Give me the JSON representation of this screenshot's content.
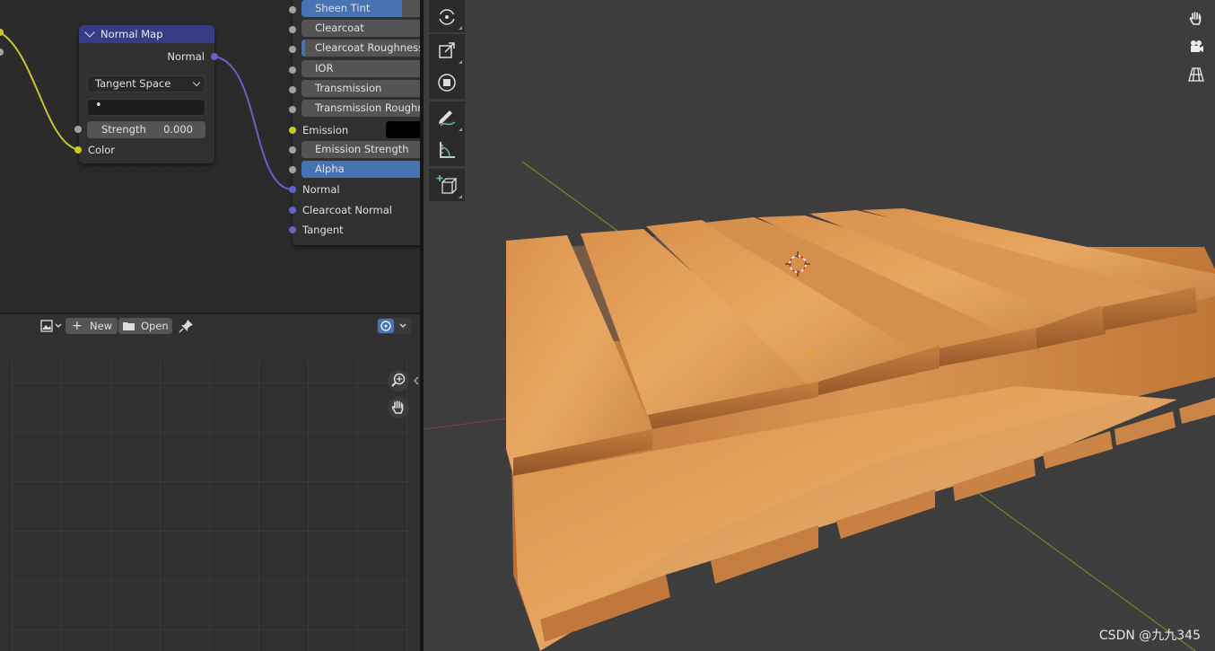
{
  "node_editor": {
    "normal_map_node": {
      "title": "Normal Map",
      "output_normal": "Normal",
      "space": "Tangent Space",
      "uv_map": "•",
      "strength_label": "Strength",
      "strength_value": "0.000",
      "input_color": "Color"
    },
    "bsdf_node": {
      "properties": [
        {
          "label": "Sheen Tint",
          "fill": 0.8
        },
        {
          "label": "Clearcoat",
          "fill": 0
        },
        {
          "label": "Clearcoat Roughness",
          "fill": 0.03
        },
        {
          "label": "IOR",
          "fill": 0
        },
        {
          "label": "Transmission",
          "fill": 0
        },
        {
          "label": "Transmission Roughness",
          "fill": 0
        }
      ],
      "emission_label": "Emission",
      "emission_color": "#000000",
      "emission_strength": "Emission Strength",
      "alpha_label": "Alpha",
      "alpha_fill": 1.0,
      "inputs": [
        "Normal",
        "Clearcoat Normal",
        "Tangent"
      ]
    },
    "link_colors": {
      "color": "#c7c729",
      "vector": "#6363c7"
    }
  },
  "image_editor": {
    "new_label": "New",
    "open_label": "Open"
  },
  "viewport": {
    "tools": [
      "rotate-view-icon",
      "scale-icon",
      "transform-icon",
      "annotate-icon",
      "measure-icon",
      "add-cube-icon"
    ],
    "gizmos": [
      "hand-pan-icon",
      "camera-icon",
      "perspective-grid-icon"
    ],
    "axis_colors": {
      "x": "#8a3a3a",
      "y": "#6a8a2a"
    }
  },
  "watermark": "CSDN @九九345"
}
